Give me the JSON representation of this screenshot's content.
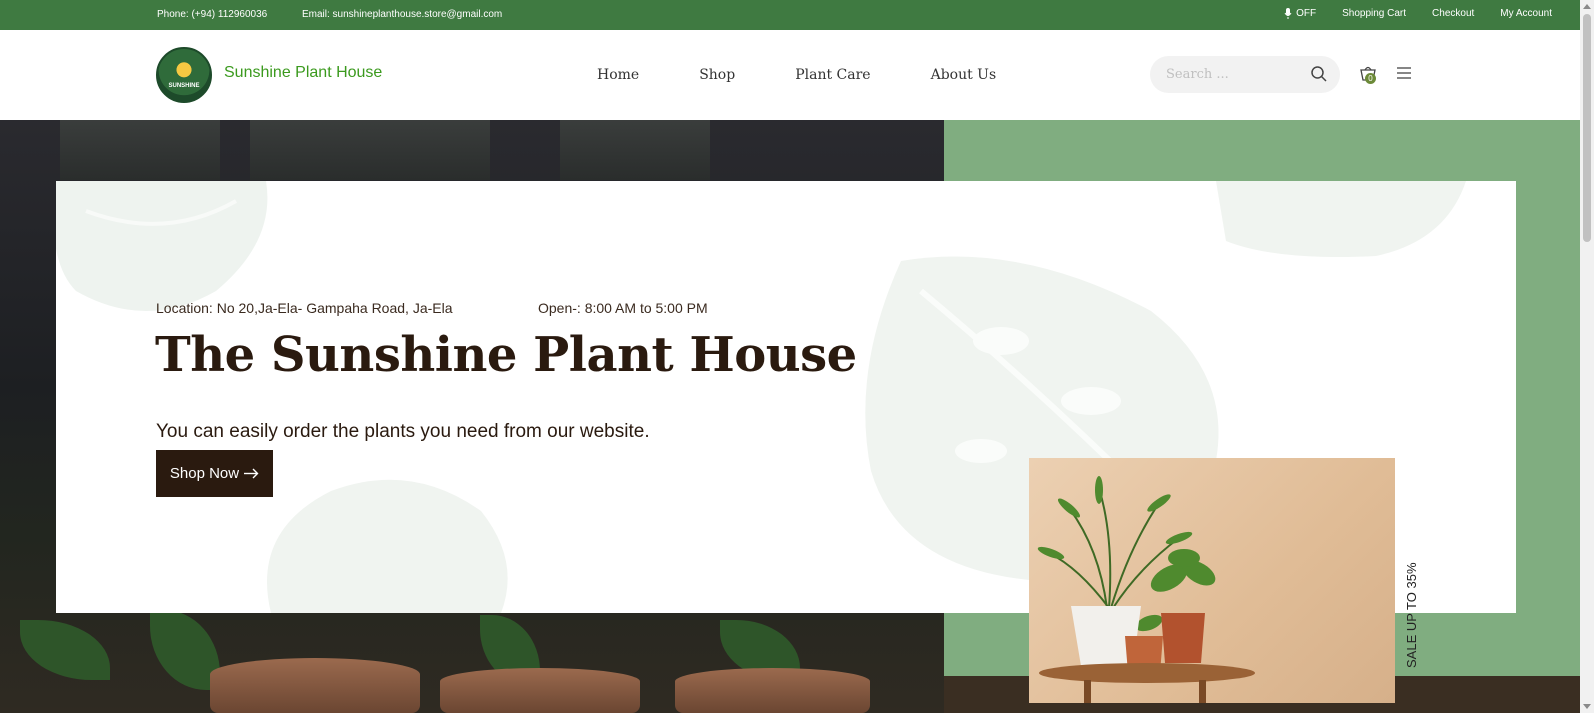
{
  "topbar": {
    "phone": "Phone: (+94) 112960036",
    "email": "Email: sunshineplanthouse.store@gmail.com",
    "voice": "OFF",
    "links": [
      "Shopping Cart",
      "Checkout",
      "My Account"
    ]
  },
  "header": {
    "logo_text": "SUNSHINE",
    "brand": "Sunshine Plant House",
    "nav": [
      "Home",
      "Shop",
      "Plant Care",
      "About Us"
    ],
    "search_placeholder": "Search ...",
    "cart_count": "0"
  },
  "hero": {
    "location": "Location: No 20,Ja-Ela- Gampaha Road, Ja-Ela",
    "hours": "Open-: 8:00 AM to 5:00 PM",
    "title": "The Sunshine Plant House",
    "subtitle": "You can easily order the plants you need from our website.",
    "cta": "Shop Now",
    "sale": "SALE UP TO 35%"
  },
  "colors": {
    "topbar": "#3f7a41",
    "brand_green": "#3b9a1e",
    "hero_green": "#80ad80",
    "dark": "#2a1a0f"
  }
}
